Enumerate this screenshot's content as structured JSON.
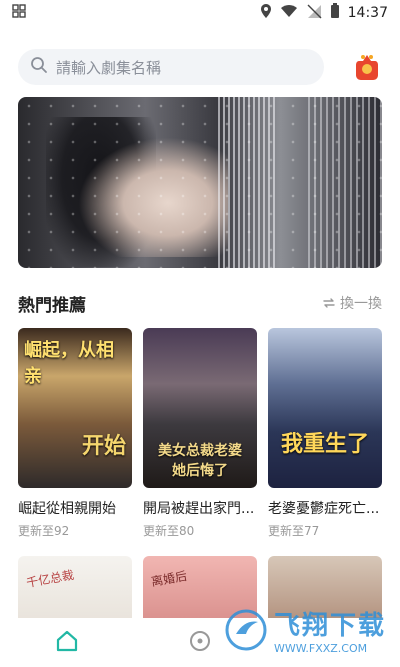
{
  "status_bar": {
    "time": "14:37"
  },
  "search": {
    "placeholder": "請輸入劇集名稱"
  },
  "section": {
    "title": "熱門推薦",
    "refresh": "換一換"
  },
  "cards": [
    {
      "title": "崛起從相親開始",
      "sub": "更新至92",
      "poster_text_top": "崛起，从相亲",
      "poster_text_bottom": "开始"
    },
    {
      "title": "開局被趕出家門...",
      "sub": "更新至80",
      "poster_text_mid": "美女总裁老婆 她后悔了"
    },
    {
      "title": "老婆憂鬱症死亡...",
      "sub": "更新至77",
      "poster_text_bottom": "我重生了"
    }
  ],
  "row2_cards": [
    {
      "poster_text": "千亿总裁"
    },
    {
      "poster_text": "离婚后"
    },
    {
      "poster_text": ""
    }
  ],
  "watermark": {
    "title": "飞翔下载",
    "url": "WWW.FXXZ.COM"
  },
  "colors": {
    "accent": "#22b8a5",
    "muted": "#999999",
    "brand_blue": "#2f8fd8"
  }
}
